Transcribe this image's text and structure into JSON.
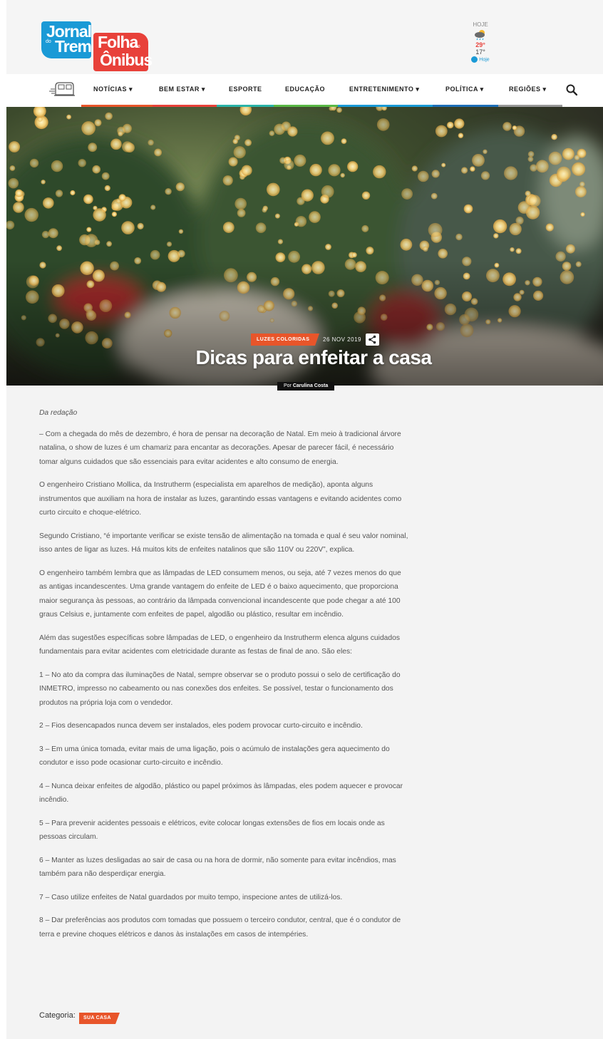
{
  "site": {
    "logo_jornal": {
      "line1": "Jornal",
      "small": "do",
      "line2": "Trem"
    },
    "logo_folha": {
      "line1": "Folha",
      "small": "do",
      "line2": "Ônibus"
    },
    "brand_colors": {
      "blue": "#1a9ad6",
      "red": "#e8413a",
      "orange": "#e8552a"
    }
  },
  "weather": {
    "label": "HOJE",
    "icon": "cloud-rain-icon",
    "max": "29°",
    "min": "17°",
    "brand": "Hoje"
  },
  "nav": {
    "bus_icon": "bus-icon",
    "items": [
      {
        "label": "NOTÍCIAS ▾"
      },
      {
        "label": "BEM ESTAR ▾"
      },
      {
        "label": "ESPORTE"
      },
      {
        "label": "EDUCAÇÃO"
      },
      {
        "label": "ENTRETENIMENTO ▾"
      },
      {
        "label": "POLÍTICA ▾"
      },
      {
        "label": "REGIÕES ▾"
      }
    ],
    "search_icon": "search-icon",
    "color_bars": [
      "#e8552a",
      "#e8413a",
      "#2ab3a8",
      "#5ab845",
      "#1a9ad6",
      "#1e6fb8",
      "#999999"
    ]
  },
  "article": {
    "tag": "LUZES COLORIDAS",
    "date": "26 NOV 2019",
    "title": "Dicas para enfeitar a casa",
    "byline_prefix": "Por ",
    "author": "Carulina Costa",
    "lead": "Da redação",
    "paragraphs": [
      "– Com a chegada do mês de dezembro, é hora de pensar na decoração de Natal. Em meio à tradicional árvore natalina, o show de luzes é um chamariz para encantar as decorações.  Apesar de parecer fácil, é necessário tomar alguns cuidados que são essenciais para evitar acidentes e alto consumo de energia.",
      "O engenheiro Cristiano Mollica, da Instrutherm (especialista em aparelhos de medição), aponta alguns instrumentos que auxiliam na hora de instalar as luzes, garantindo essas vantagens e evitando acidentes como curto circuito e choque-elétrico.",
      "Segundo Cristiano, “é importante verificar se existe tensão de alimentação na tomada e qual é seu valor nominal, isso antes de ligar as luzes. Há muitos kits de enfeites natalinos que são 110V ou 220V”, explica.",
      "O engenheiro também lembra que as lâmpadas de LED consumem menos, ou seja, até 7 vezes menos do que as antigas incandescentes. Uma grande vantagem do enfeite de LED é o baixo aquecimento, que proporciona maior segurança às pessoas, ao contrário da lâmpada convencional incandescente que pode chegar a até 100 graus Celsius e, juntamente com enfeites de papel, algodão ou plástico, resultar em incêndio.",
      "Além das sugestões específicas sobre lâmpadas de LED, o engenheiro da Instrutherm elenca alguns cuidados fundamentais para evitar acidentes com eletricidade durante as festas de final de ano. São eles:",
      "1 – No ato da compra das iluminações de Natal, sempre observar se o produto possui o selo de certificação do INMETRO, impresso no cabeamento ou nas conexões dos enfeites. Se possível, testar o funcionamento dos produtos na própria loja com o vendedor.",
      "2 – Fios desencapados nunca devem ser instalados, eles podem provocar curto-circuito e incêndio.",
      "3 – Em uma única tomada, evitar mais de uma ligação, pois o acúmulo de instalações gera aquecimento do condutor e isso pode ocasionar curto-circuito e incêndio.",
      "4 – Nunca deixar enfeites de algodão, plástico ou papel próximos às lâmpadas, eles podem aquecer e provocar incêndio.",
      "5 – Para prevenir acidentes pessoais e elétricos, evite colocar longas extensões de fios em locais onde as pessoas circulam.",
      "6 – Manter as luzes desligadas ao sair de casa ou na hora de dormir, não somente para evitar incêndios, mas também para não desperdiçar energia.",
      "7 – Caso utilize enfeites de Natal guardados por muito tempo, inspecione antes de utilizá-los.",
      "8 – Dar preferências aos produtos com tomadas que possuem o terceiro condutor, central, que é o condutor de terra e previne choques elétricos e danos às instalações em casos de intempéries."
    ],
    "category_label": "Categoria:",
    "category": "SUA CASA",
    "share_icon": "share-icon"
  }
}
